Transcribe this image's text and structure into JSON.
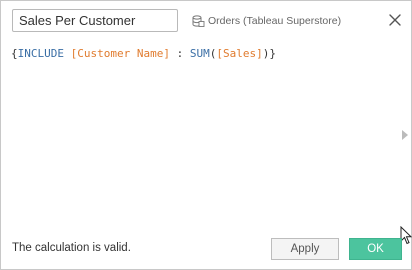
{
  "calc_name": "Sales Per Customer",
  "datasource": {
    "label": "Orders (Tableau Superstore)",
    "icon": "datasource-icon"
  },
  "close_icon": "close-icon",
  "formula": {
    "open_brace": "{",
    "keyword": "INCLUDE",
    "field1": "[Customer Name]",
    "colon": " : ",
    "function": "SUM",
    "open_paren": "(",
    "field2": "[Sales]",
    "close_paren": ")",
    "close_brace": "}"
  },
  "colors": {
    "keyword": "#3a6ea5",
    "field": "#e07b2e",
    "ok_button": "#4cc49e"
  },
  "status": "The calculation is valid.",
  "buttons": {
    "apply": "Apply",
    "ok": "OK"
  }
}
